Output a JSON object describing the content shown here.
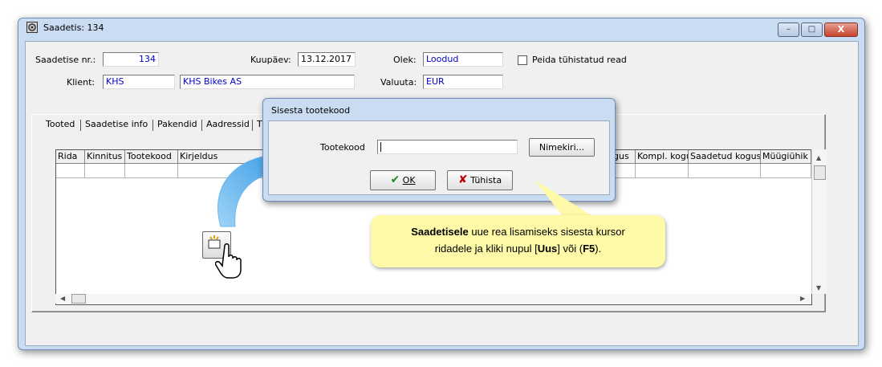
{
  "window": {
    "title": "Saadetis: 134",
    "controls": {
      "minimize": "–",
      "maximize": "□",
      "close": "X"
    }
  },
  "header": {
    "saadetise_nr": {
      "label": "Saadetise nr.:",
      "value": "134"
    },
    "kuupaev": {
      "label": "Kuupäev:",
      "value": "13.12.2017"
    },
    "olek": {
      "label": "Olek:",
      "value": "Loodud"
    },
    "peida": {
      "label": "Peida tühistatud read",
      "checked": false
    },
    "klient": {
      "label": "Klient:",
      "code": "KHS",
      "name": "KHS Bikes AS"
    },
    "valuuta": {
      "label": "Valuuta:",
      "value": "EUR"
    }
  },
  "tabs": [
    "Tooted",
    "Saadetise info",
    "Pakendid",
    "Aadressid",
    "T"
  ],
  "grid": {
    "columns_left": [
      "Rida",
      "Kinnitus",
      "Tootekood",
      "Kirjeldus"
    ],
    "columns_right": [
      "gus",
      "Kompl. kogu",
      "Saadetud kogus",
      "Müügiühik"
    ]
  },
  "dialog": {
    "title": "Sisesta tootekood",
    "field_label": "Tootekood",
    "field_value": "",
    "list_button": "Nimekiri...",
    "ok_label": "OK",
    "cancel_label": "Tühista"
  },
  "callout": {
    "bold_lead": "Saadetisele",
    "text1": " uue rea lisamiseks sisesta kursor",
    "text2": "ridadele ja kliki nupul [",
    "bold_uus": "Uus",
    "text3": "] või (",
    "bold_f5": "F5",
    "text4": ")."
  },
  "colors": {
    "value_text": "#0000cc",
    "callout_bg": "#fffaa8",
    "arrow": "#3aa0e6"
  }
}
